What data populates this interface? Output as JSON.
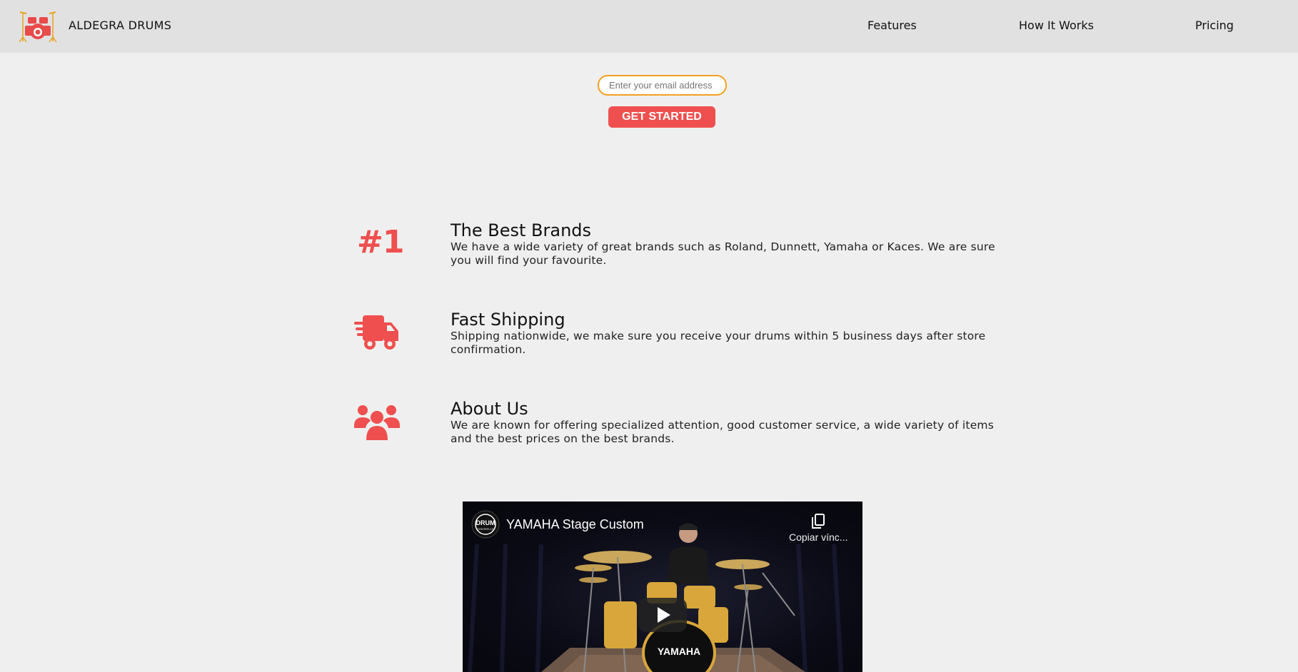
{
  "header": {
    "brand": "ALDEGRA DRUMS",
    "nav": {
      "features": "Features",
      "how_it_works": "How It Works",
      "pricing": "Pricing"
    }
  },
  "form": {
    "email_placeholder": "Enter your email address",
    "email_value": "",
    "submit_label": "GET STARTED"
  },
  "features": [
    {
      "icon": "number-one",
      "icon_text": "#1",
      "title": "The Best Brands",
      "description": "We have a wide variety of great brands such as Roland, Dunnett, Yamaha or Kaces. We are sure you will find your favourite."
    },
    {
      "icon": "truck-icon",
      "title": "Fast Shipping",
      "description": "Shipping nationwide, we make sure you receive your drums within 5 business days after store confirmation."
    },
    {
      "icon": "users-icon",
      "title": "About Us",
      "description": "We are known for offering specialized attention, good customer service, a wide variety of items and the best prices on the best brands."
    }
  ],
  "video": {
    "title": "YAMAHA Stage Custom",
    "copy_link_label": "Copiar vínc...",
    "channel_logo_text": "DRUM",
    "channel_logo_subtext": "CENTER.CZ",
    "bass_drum_brand": "YAMAHA"
  },
  "colors": {
    "accent": "#ef4f4f",
    "input_border": "#f3a022",
    "header_bg": "#e1e1e1",
    "page_bg": "#efefef"
  }
}
